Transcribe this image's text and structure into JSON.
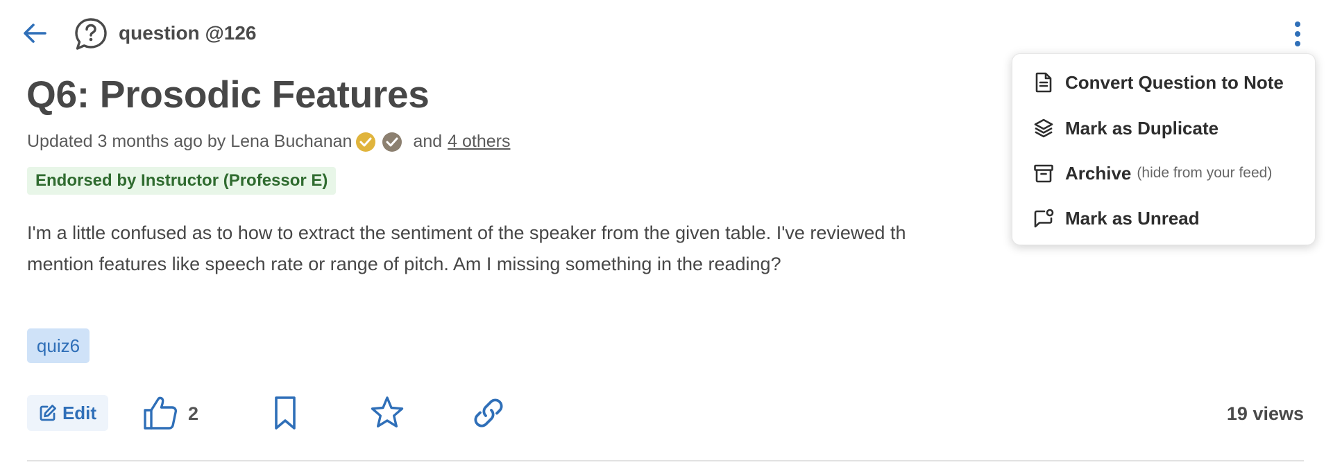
{
  "header": {
    "question_label": "question @126"
  },
  "post": {
    "title": "Q6: Prosodic Features",
    "updated_prefix": "Updated 3 months ago by Lena Buchanan",
    "updated_and": "and",
    "others_link": "4 others",
    "endorsement": "Endorsed by Instructor (Professor E)",
    "body_lines": [
      "I'm a little confused as to how to extract the sentiment of the speaker from the given table.  I've reviewed th",
      "mention features like speech rate or range of pitch.  Am I missing something in the reading?"
    ],
    "tag": "quiz6"
  },
  "actions": {
    "edit_label": "Edit",
    "like_count": "2",
    "views": "19 views"
  },
  "menu": {
    "items": [
      {
        "label": "Convert Question to Note",
        "note": "",
        "icon": "document-icon"
      },
      {
        "label": "Mark as Duplicate",
        "note": "",
        "icon": "layers-icon"
      },
      {
        "label": "Archive",
        "note": "(hide from your feed)",
        "icon": "archive-icon"
      },
      {
        "label": "Mark as Unread",
        "note": "",
        "icon": "unread-icon"
      }
    ]
  },
  "colors": {
    "accent": "#2f6fb8",
    "endorsed_bg": "#e8f6e8",
    "endorsed_text": "#2f6b2f",
    "tag_bg": "#cfe2f8",
    "badge_gold": "#e0b43c",
    "badge_gray": "#8c8070"
  }
}
